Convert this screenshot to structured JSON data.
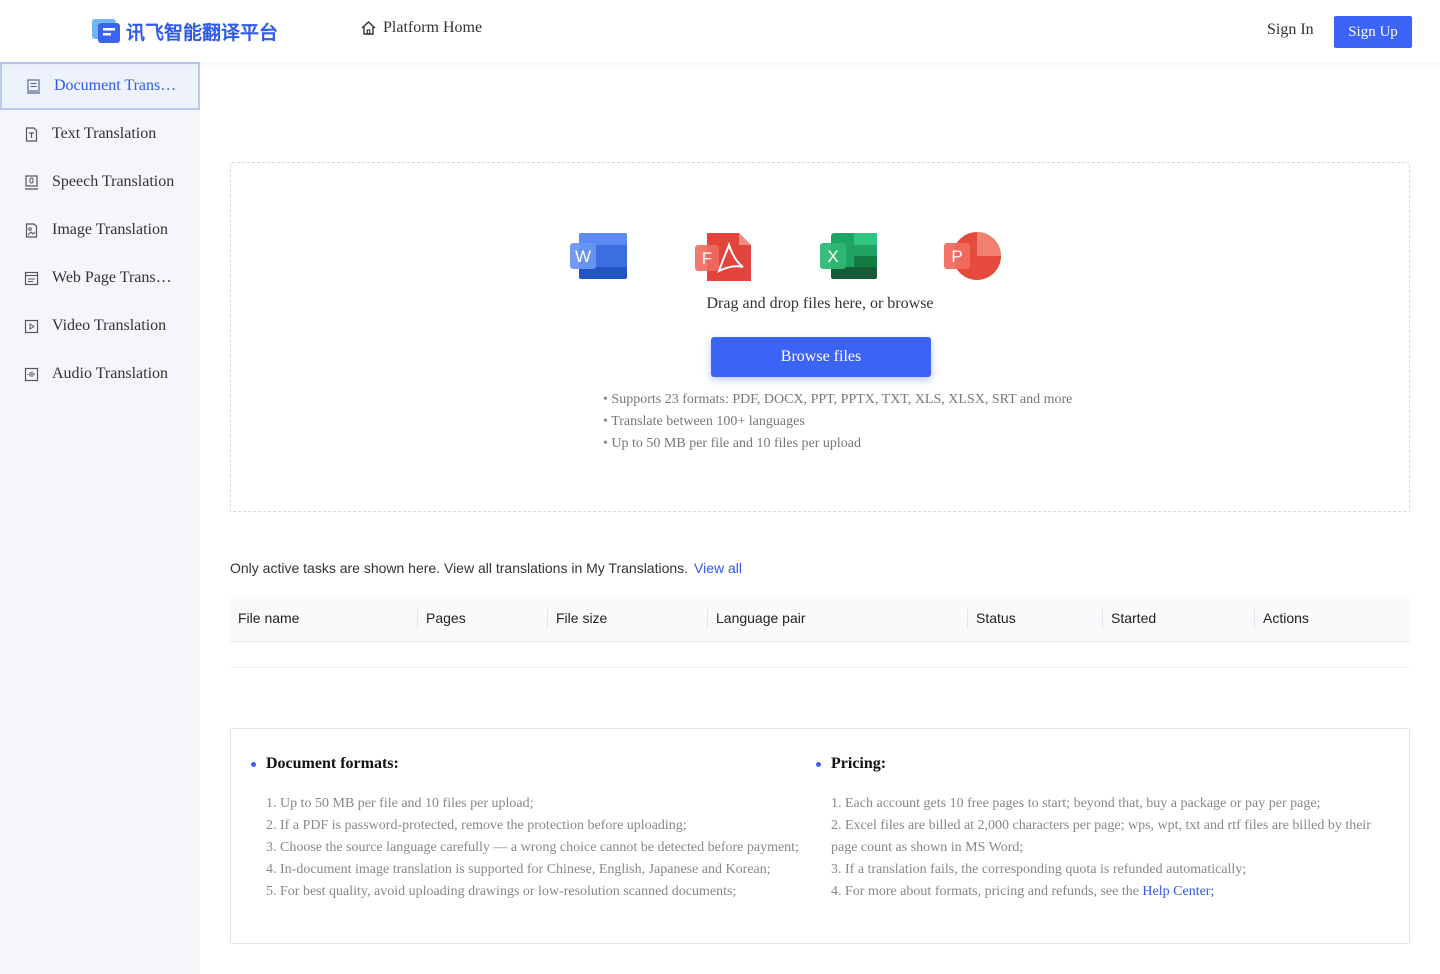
{
  "header": {
    "logo_text": "讯飞智能翻译平台",
    "platform_home": "Platform Home",
    "sign_in": "Sign In",
    "sign_up": "Sign Up"
  },
  "sidebar": {
    "items": [
      {
        "label": "Document Translation",
        "icon": "document-icon",
        "active": true
      },
      {
        "label": "Text Translation",
        "icon": "text-icon",
        "active": false
      },
      {
        "label": "Speech Translation",
        "icon": "speech-icon",
        "active": false
      },
      {
        "label": "Image Translation",
        "icon": "image-icon",
        "active": false
      },
      {
        "label": "Web Page Translation",
        "icon": "webpage-icon",
        "active": false
      },
      {
        "label": "Video Translation",
        "icon": "video-icon",
        "active": false
      },
      {
        "label": "Audio Translation",
        "icon": "audio-icon",
        "active": false
      }
    ]
  },
  "upload": {
    "file_icons": [
      {
        "name": "word-icon",
        "letter": "W",
        "color": "#2b5fd9"
      },
      {
        "name": "pdf-icon",
        "letter": "F",
        "color": "#e0443a"
      },
      {
        "name": "excel-icon",
        "letter": "X",
        "color": "#1f9d55"
      },
      {
        "name": "powerpoint-icon",
        "letter": "P",
        "color": "#e64a3c"
      }
    ],
    "drop_text": "Drag and drop files here, or browse",
    "browse_button": "Browse files",
    "bullets": [
      "Supports 23 formats: PDF, DOCX, PPT, PPTX, TXT, XLS, XLSX, SRT and more",
      "Translate between 100+ languages",
      "Up to 50 MB per file and 10 files per upload"
    ]
  },
  "tasks": {
    "note": "Only active tasks are shown here. View all translations in My Translations.",
    "view_all": "View all",
    "columns": [
      "File name",
      "Pages",
      "File size",
      "Language pair",
      "Status",
      "Started",
      "Actions"
    ]
  },
  "info": {
    "formats_title": "Document formats:",
    "formats_items": [
      "1. Up to 50 MB per file and 10 files per upload;",
      "2. If a PDF is password-protected, remove the protection before uploading;",
      "3. Choose the source language carefully — a wrong choice cannot be detected before payment;",
      "4. In-document image translation is supported for Chinese, English, Japanese and Korean;",
      "5. For best quality, avoid uploading drawings or low-resolution scanned documents;"
    ],
    "pricing_title": "Pricing:",
    "pricing_items": [
      "1. Each account gets 10 free pages to start; beyond that, buy a package or pay per page;",
      "2. Excel files are billed at 2,000 characters per page; wps, wpt, txt and rtf files are billed by their page count as shown in MS Word;",
      "3. If a translation fails, the corresponding quota is refunded automatically;"
    ],
    "pricing_last_prefix": "4. For more about formats, pricing and refunds, see the ",
    "help_center": "Help Center;"
  },
  "colors": {
    "accent": "#3b63f6",
    "sidebar_bg": "#f5f6fa"
  }
}
